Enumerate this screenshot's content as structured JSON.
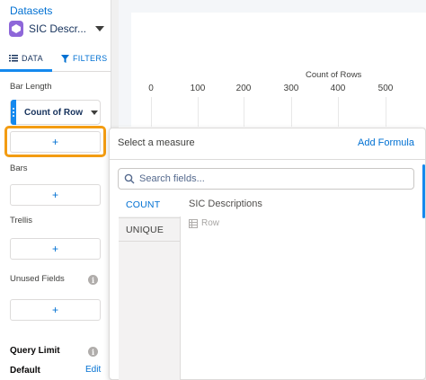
{
  "sidebar": {
    "datasets_title": "Datasets",
    "dataset_name": "SIC Descr...",
    "tabs": [
      {
        "label": "DATA",
        "icon": "list-icon"
      },
      {
        "label": "FILTERS",
        "icon": "filter-icon"
      }
    ],
    "bar_length_label": "Bar Length",
    "measure_pill": "Count of Row",
    "add_symbol": "+",
    "bars_label": "Bars",
    "trellis_label": "Trellis",
    "unused_fields_label": "Unused Fields",
    "query_limit_label": "Query Limit",
    "default_label": "Default",
    "edit_label": "Edit",
    "info_glyph": "i"
  },
  "chart": {
    "axis_title": "Count of Rows",
    "ticks": [
      "0",
      "100",
      "200",
      "300",
      "400",
      "500"
    ]
  },
  "popover": {
    "title": "Select a measure",
    "add_formula": "Add Formula",
    "search_placeholder": "Search fields...",
    "aggregations": [
      "COUNT",
      "UNIQUE"
    ],
    "field_group": "SIC Descriptions",
    "field_item": "Row"
  },
  "colors": {
    "accent": "#0070d2",
    "highlight": "#f39c12",
    "dataset_icon": "#8e67d9"
  }
}
